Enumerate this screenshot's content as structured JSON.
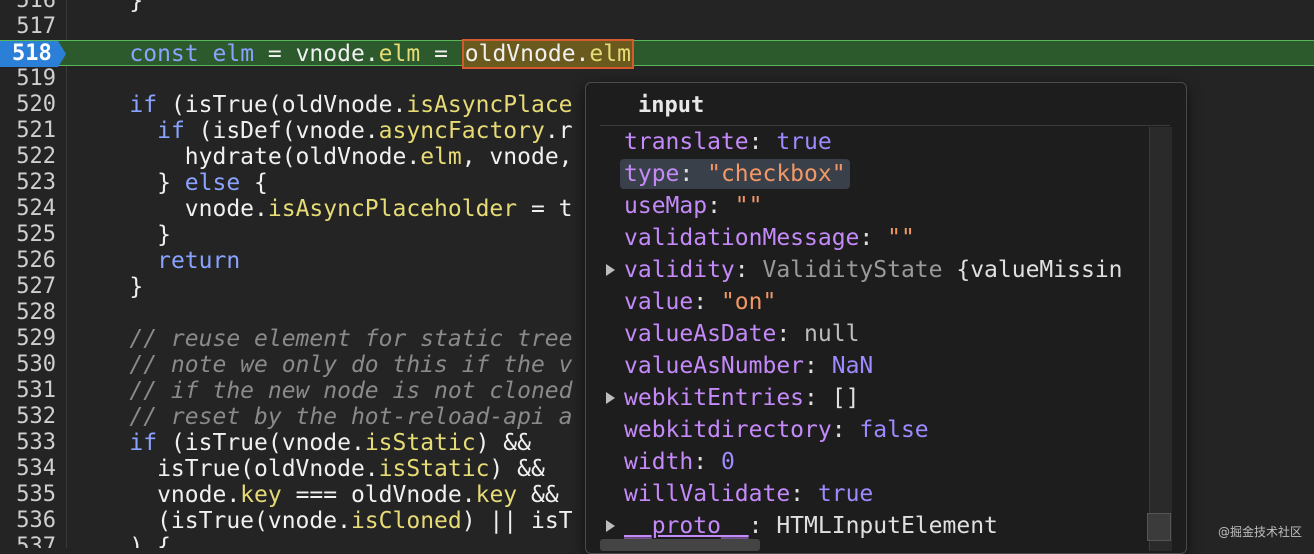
{
  "editor": {
    "lines": [
      {
        "n": "516",
        "html": [
          {
            "t": "    }",
            "c": ""
          }
        ]
      },
      {
        "n": "517",
        "html": []
      },
      {
        "n": "518",
        "active": true,
        "html": [
          {
            "t": "    ",
            "c": ""
          },
          {
            "t": "const",
            "c": "kw"
          },
          {
            "t": " ",
            "c": ""
          },
          {
            "t": "elm",
            "c": "kw"
          },
          {
            "t": " = vnode.",
            "c": ""
          },
          {
            "t": "elm",
            "c": "pr"
          },
          {
            "t": " = ",
            "c": ""
          },
          {
            "t": "oldVnode.",
            "c": "hl-start"
          },
          {
            "t": "elm",
            "c": "hl-end"
          }
        ]
      },
      {
        "n": "519",
        "html": []
      },
      {
        "n": "520",
        "html": [
          {
            "t": "    ",
            "c": ""
          },
          {
            "t": "if",
            "c": "kw"
          },
          {
            "t": " (isTrue(oldVnode.",
            "c": ""
          },
          {
            "t": "isAsyncPlace",
            "c": "pr"
          }
        ]
      },
      {
        "n": "521",
        "html": [
          {
            "t": "      ",
            "c": ""
          },
          {
            "t": "if",
            "c": "kw"
          },
          {
            "t": " (isDef(vnode.",
            "c": ""
          },
          {
            "t": "asyncFactory",
            "c": "pr"
          },
          {
            "t": ".r",
            "c": ""
          }
        ]
      },
      {
        "n": "522",
        "html": [
          {
            "t": "        hydrate(oldVnode.",
            "c": ""
          },
          {
            "t": "elm",
            "c": "pr"
          },
          {
            "t": ", vnode,",
            "c": ""
          }
        ]
      },
      {
        "n": "523",
        "html": [
          {
            "t": "      } ",
            "c": ""
          },
          {
            "t": "else",
            "c": "kw"
          },
          {
            "t": " {",
            "c": ""
          }
        ]
      },
      {
        "n": "524",
        "html": [
          {
            "t": "        vnode.",
            "c": ""
          },
          {
            "t": "isAsyncPlaceholder",
            "c": "pr"
          },
          {
            "t": " = t",
            "c": ""
          }
        ]
      },
      {
        "n": "525",
        "html": [
          {
            "t": "      }",
            "c": ""
          }
        ]
      },
      {
        "n": "526",
        "html": [
          {
            "t": "      ",
            "c": ""
          },
          {
            "t": "return",
            "c": "kw"
          }
        ]
      },
      {
        "n": "527",
        "html": [
          {
            "t": "    }",
            "c": ""
          }
        ]
      },
      {
        "n": "528",
        "html": []
      },
      {
        "n": "529",
        "html": [
          {
            "t": "    ",
            "c": ""
          },
          {
            "t": "// reuse element for static tree",
            "c": "cm"
          }
        ]
      },
      {
        "n": "530",
        "html": [
          {
            "t": "    ",
            "c": ""
          },
          {
            "t": "// note we only do this if the v",
            "c": "cm"
          }
        ]
      },
      {
        "n": "531",
        "html": [
          {
            "t": "    ",
            "c": ""
          },
          {
            "t": "// if the new node is not cloned",
            "c": "cm"
          }
        ]
      },
      {
        "n": "532",
        "html": [
          {
            "t": "    ",
            "c": ""
          },
          {
            "t": "// reset by the hot-reload-api a",
            "c": "cm"
          }
        ]
      },
      {
        "n": "533",
        "html": [
          {
            "t": "    ",
            "c": ""
          },
          {
            "t": "if",
            "c": "kw"
          },
          {
            "t": " (isTrue(vnode.",
            "c": ""
          },
          {
            "t": "isStatic",
            "c": "pr"
          },
          {
            "t": ") &&",
            "c": ""
          }
        ]
      },
      {
        "n": "534",
        "html": [
          {
            "t": "      isTrue(oldVnode.",
            "c": ""
          },
          {
            "t": "isStatic",
            "c": "pr"
          },
          {
            "t": ") &&",
            "c": ""
          }
        ]
      },
      {
        "n": "535",
        "html": [
          {
            "t": "      vnode.",
            "c": ""
          },
          {
            "t": "key",
            "c": "pr"
          },
          {
            "t": " === oldVnode.",
            "c": ""
          },
          {
            "t": "key",
            "c": "pr"
          },
          {
            "t": " &&",
            "c": ""
          }
        ]
      },
      {
        "n": "536",
        "html": [
          {
            "t": "      (isTrue(vnode.",
            "c": ""
          },
          {
            "t": "isCloned",
            "c": "pr"
          },
          {
            "t": ") || isT",
            "c": ""
          }
        ]
      },
      {
        "n": "537",
        "html": [
          {
            "t": "    ) {",
            "c": ""
          }
        ]
      }
    ]
  },
  "popover": {
    "title": "input",
    "props": [
      {
        "name": "translate",
        "value": "true",
        "vc": "bool"
      },
      {
        "name": "type",
        "value": "\"checkbox\"",
        "vc": "str",
        "selected": true
      },
      {
        "name": "useMap",
        "value": "\"\"",
        "vc": "str"
      },
      {
        "name": "validationMessage",
        "value": "\"\"",
        "vc": "str"
      },
      {
        "name": "validity",
        "value": "ValidityState",
        "vc": "cls",
        "extra": " {valueMissin",
        "expandable": true
      },
      {
        "name": "value",
        "value": "\"on\"",
        "vc": "str"
      },
      {
        "name": "valueAsDate",
        "value": "null",
        "vc": "nul"
      },
      {
        "name": "valueAsNumber",
        "value": "NaN",
        "vc": "num"
      },
      {
        "name": "webkitEntries",
        "value": "[]",
        "vc": "plain",
        "expandable": true
      },
      {
        "name": "webkitdirectory",
        "value": "false",
        "vc": "bool"
      },
      {
        "name": "width",
        "value": "0",
        "vc": "num"
      },
      {
        "name": "willValidate",
        "value": "true",
        "vc": "bool"
      },
      {
        "name": "__proto__",
        "value": "HTMLInputElement",
        "vc": "plain",
        "expandable": true,
        "proto": true
      }
    ]
  },
  "watermark": "@掘金技术社区"
}
